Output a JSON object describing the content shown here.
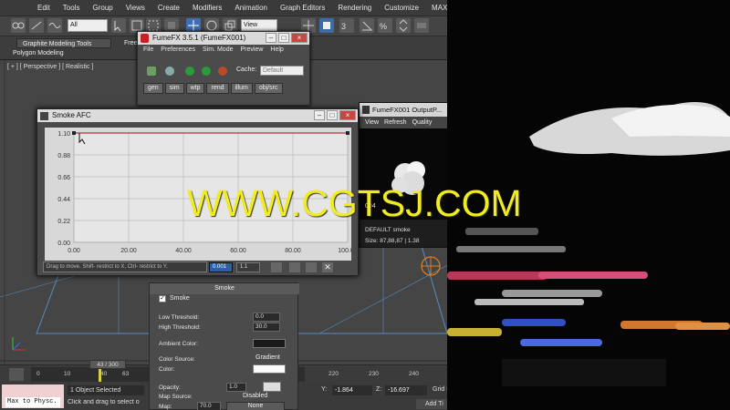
{
  "menubar": {
    "items": [
      "Edit",
      "Tools",
      "Group",
      "Views",
      "Create",
      "Modifiers",
      "Animation",
      "Graph Editors",
      "Rendering",
      "Customize",
      "MAXScript"
    ]
  },
  "toolbar": {
    "filter_value": "All",
    "view_value": "View"
  },
  "ribbon": {
    "tab_active": "Graphite Modeling Tools",
    "tab_partial": "Free",
    "sub_label": "Polygon Modeling"
  },
  "viewport": {
    "label": "[ + ] [ Perspective ] [ Realistic ]"
  },
  "fumefx": {
    "title": "FumeFX 3.5.1 (FumeFX001)",
    "menu": [
      "File",
      "Preferences",
      "Sim. Mode",
      "Preview",
      "Help"
    ],
    "cache_label": "Cache:",
    "cache_value": "Default",
    "buttons": [
      "gen",
      "sim",
      "wtp",
      "rend",
      "illum",
      "obj/src"
    ]
  },
  "afc": {
    "title": "Smoke AFC",
    "status_hint": "Drag to move. Shift- restrict to X, Ctrl- restrict to Y.",
    "field1": "0.001",
    "field2": "1.1"
  },
  "chart_data": {
    "type": "line",
    "title": "",
    "xlabel": "",
    "ylabel": "",
    "x": [
      0,
      100
    ],
    "y": [
      1.1,
      1.1
    ],
    "xlim": [
      0,
      100
    ],
    "ylim": [
      0,
      1.1
    ],
    "xticks": [
      "0.00",
      "20.00",
      "40.00",
      "60.00",
      "80.00",
      "100.00"
    ],
    "yticks": [
      "1.10",
      "0.88",
      "0.66",
      "0.44",
      "0.22",
      "0.00"
    ],
    "grid": true,
    "line_color": "#c03040"
  },
  "smoke_panel": {
    "header": "Smoke",
    "checkbox_label": "Smoke",
    "low_threshold_label": "Low Threshold:",
    "low_threshold": "0.0",
    "high_threshold_label": "High Threshold:",
    "high_threshold": "30.0",
    "ambient_label": "Ambient Color:",
    "color_source_label": "Color Source:",
    "color_source_value": "Gradient",
    "color_label": "Color:",
    "opacity_label": "Opacity:",
    "opacity_value": "1.0",
    "map_source_label": "Map Source:",
    "map_source_value": "Disabled",
    "map_label": "Map:",
    "map_value": "70.0",
    "map_button": "None"
  },
  "output": {
    "title": "FumeFX001 OutputP...",
    "menu": [
      "View",
      "Refresh",
      "Quality"
    ],
    "frame_partial": "004",
    "caption": "DEFAULT smoke",
    "size": "Size: 87,88,87 | 1.38"
  },
  "timeline": {
    "frame": "43 / 300",
    "ticks": [
      "0",
      "10",
      "40",
      "63",
      "220",
      "230",
      "240"
    ]
  },
  "status": {
    "script_box": "Max to Physc.",
    "selection": "1 Object Selected",
    "hint": "Click and drag to select o",
    "y_label": "Y:",
    "y_value": "-1.864",
    "z_label": "Z:",
    "z_value": "-16.697",
    "grid_partial": "Grid = ",
    "add_partial": "Add Ti"
  },
  "watermark": "WWW.CGTSJ.COM"
}
